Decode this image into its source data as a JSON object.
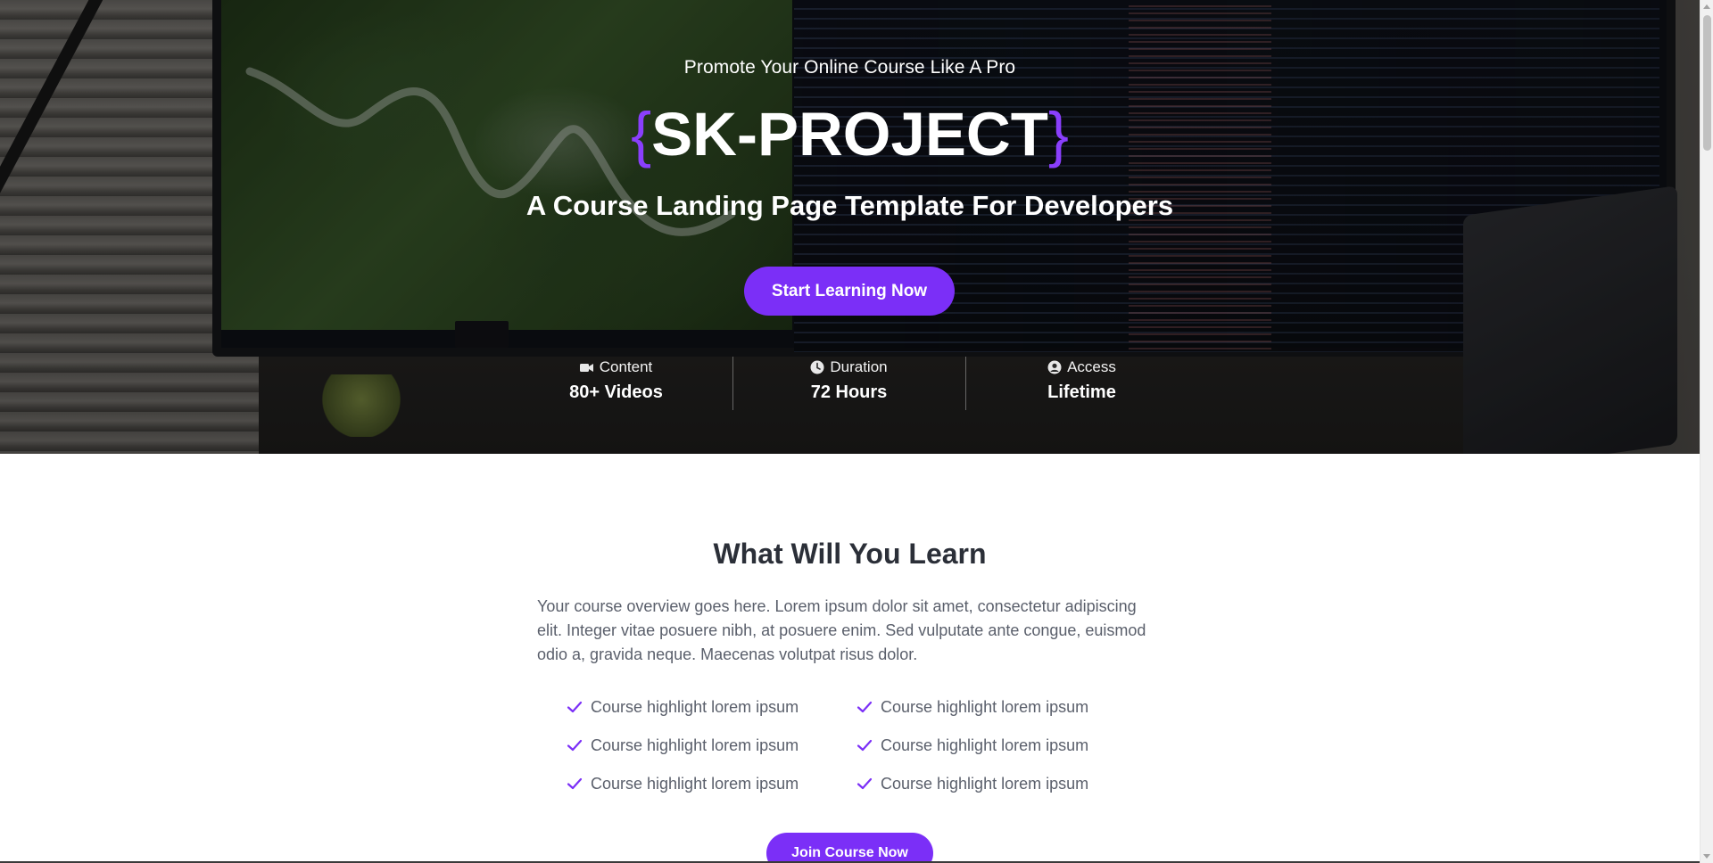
{
  "hero": {
    "tagline": "Promote Your Online Course Like A Pro",
    "brand_open": "{",
    "brand_name": "SK-PROJECT",
    "brand_close": "}",
    "subtitle": "A Course Landing Page Template For Developers",
    "cta_label": "Start Learning Now",
    "stats": [
      {
        "icon": "video-camera-icon",
        "label": "Content",
        "value": "80+ Videos"
      },
      {
        "icon": "clock-icon",
        "label": "Duration",
        "value": "72 Hours"
      },
      {
        "icon": "user-circle-icon",
        "label": "Access",
        "value": "Lifetime"
      }
    ]
  },
  "learn": {
    "title": "What Will You Learn",
    "text": "Your course overview goes here. Lorem ipsum dolor sit amet, consectetur adipiscing elit. Integer vitae posuere nibh, at posuere enim. Sed vulputate ante congue, euismod odio a, gravida neque. Maecenas volutpat risus dolor.",
    "highlights": [
      "Course highlight lorem ipsum",
      "Course highlight lorem ipsum",
      "Course highlight lorem ipsum",
      "Course highlight lorem ipsum",
      "Course highlight lorem ipsum",
      "Course highlight lorem ipsum"
    ],
    "join_label": "Join Course Now"
  },
  "colors": {
    "accent": "#7b2ff7",
    "brace": "#8a3ffc",
    "heading": "#2b2f38",
    "body_text": "#5a5f6b"
  }
}
